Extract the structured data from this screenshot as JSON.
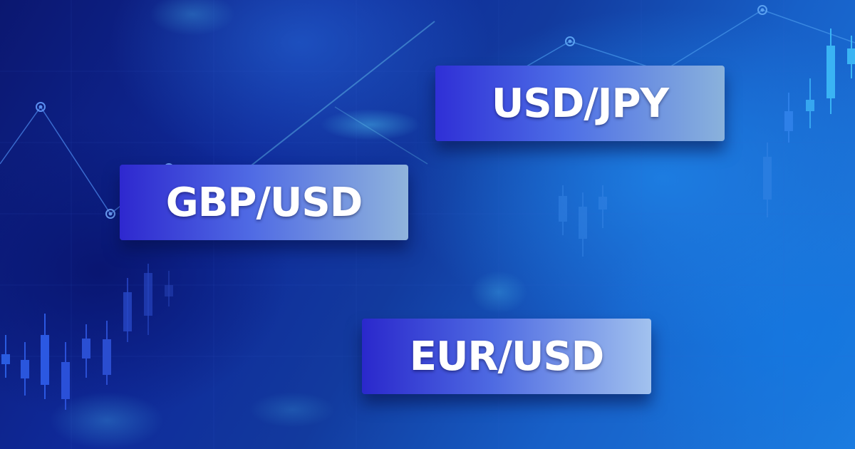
{
  "theme": {
    "background_dark": "#0b1770",
    "background_light": "#1d7de0",
    "label_text_color": "#ffffff"
  },
  "labels": {
    "usdjpy": "USD/JPY",
    "gbpusd": "GBP/USD",
    "eurusd": "EUR/USD"
  }
}
